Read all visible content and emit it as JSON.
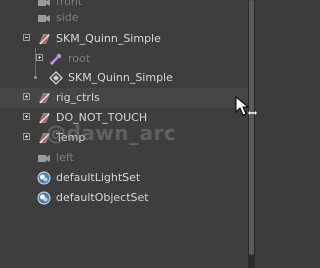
{
  "outliner": {
    "items": [
      {
        "label": "front"
      },
      {
        "label": "side"
      },
      {
        "label": "SKM_Quinn_Simple"
      },
      {
        "label": "root"
      },
      {
        "label": "SKM_Quinn_Simple"
      },
      {
        "label": "rig_ctrls"
      },
      {
        "label": "DO_NOT_TOUCH"
      },
      {
        "label": "Temp"
      },
      {
        "label": "left"
      },
      {
        "label": "defaultLightSet"
      },
      {
        "label": "defaultObjectSet"
      }
    ]
  },
  "watermark": "@dawn_arc",
  "colors": {
    "background": "#3e3e3e",
    "text": "#d6d6d6",
    "dim_text": "#7c7c7c",
    "joint_purple": "#b98ce6",
    "group_icon_red": "#d14b4b"
  }
}
